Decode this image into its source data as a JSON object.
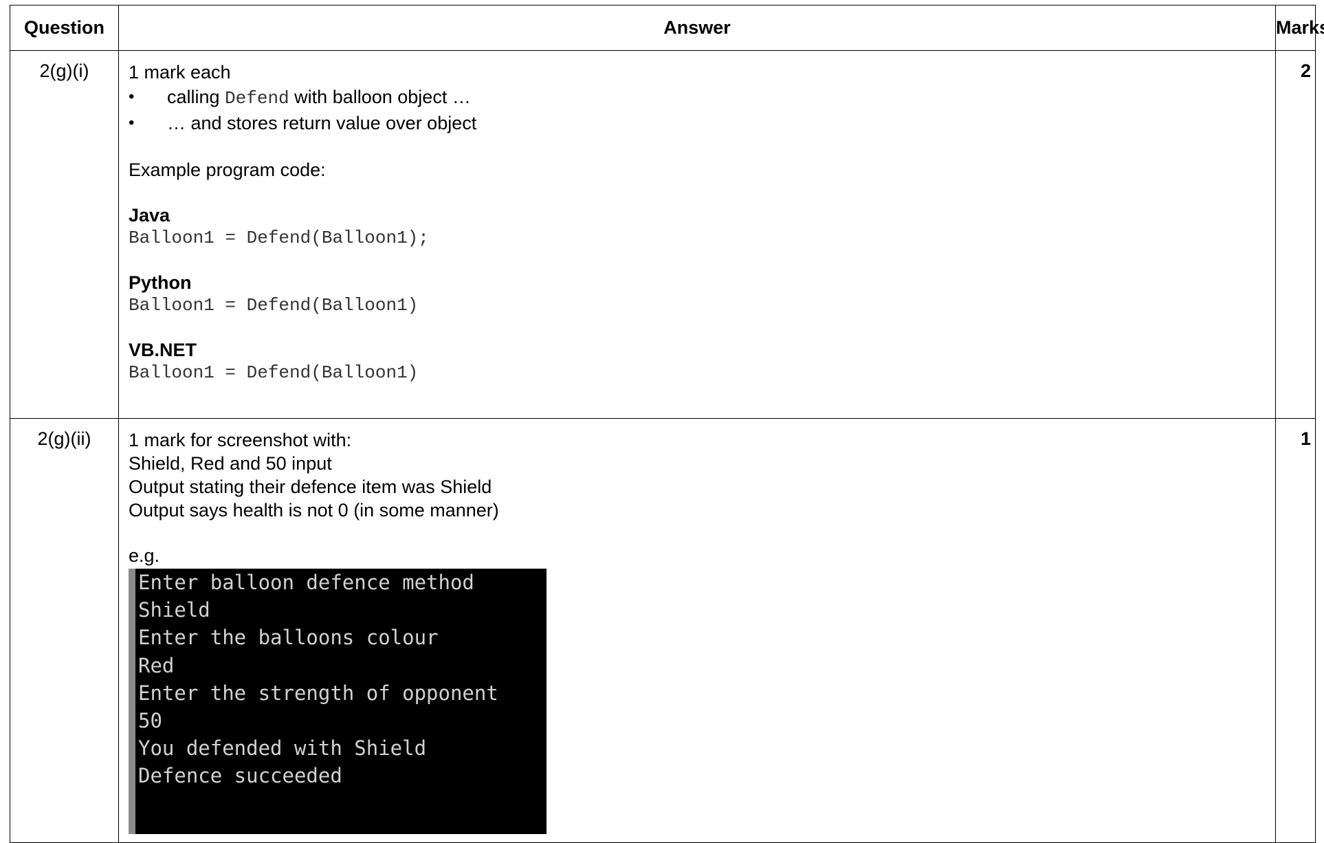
{
  "headers": {
    "question": "Question",
    "answer": "Answer",
    "marks": "Marks"
  },
  "rows": [
    {
      "question": "2(g)(i)",
      "marks": "2",
      "intro": "1 mark each",
      "bullets": [
        {
          "pre": "calling ",
          "code": "Defend",
          "post": " with balloon object …"
        },
        {
          "pre": "… and stores return value over object",
          "code": "",
          "post": ""
        }
      ],
      "example_label": "Example program code:",
      "languages": [
        {
          "name": "Java",
          "code": "Balloon1 = Defend(Balloon1);"
        },
        {
          "name": "Python",
          "code": "Balloon1 = Defend(Balloon1)"
        },
        {
          "name": "VB.NET",
          "code": "Balloon1 = Defend(Balloon1)"
        }
      ]
    },
    {
      "question": "2(g)(ii)",
      "marks": "1",
      "lines": [
        "1 mark for screenshot with:",
        "Shield, Red and 50 input",
        "Output stating their defence item was Shield",
        "Output says health is not 0 (in some manner)"
      ],
      "eg_label": "e.g.",
      "console_lines": [
        "Enter balloon defence method",
        "Shield",
        "Enter the balloons colour",
        "Red",
        "Enter the strength of opponent",
        "50",
        "You defended with Shield",
        "Defence succeeded"
      ]
    }
  ]
}
